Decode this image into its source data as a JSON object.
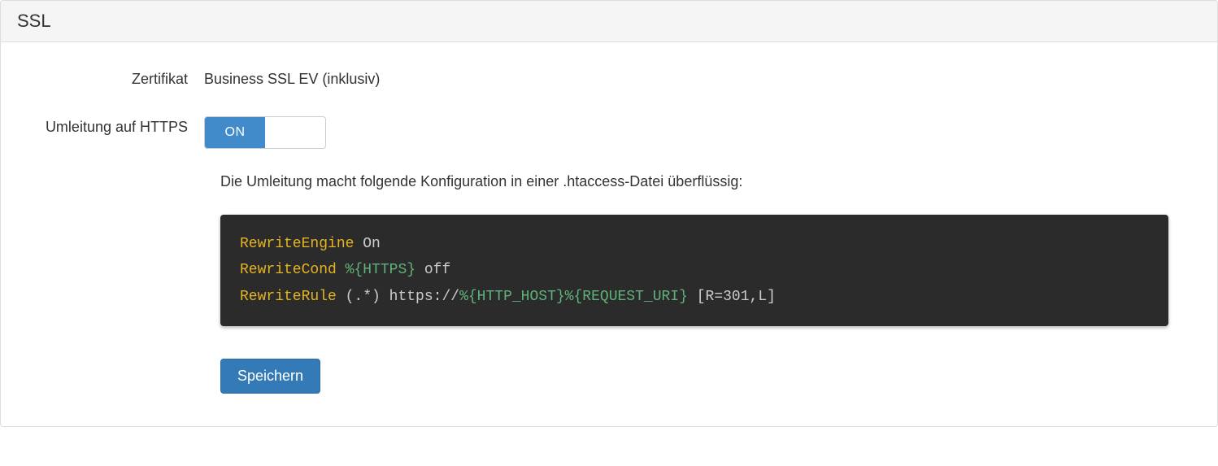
{
  "panel": {
    "title": "SSL"
  },
  "fields": {
    "certificate": {
      "label": "Zertifikat",
      "value": "Business SSL EV (inklusiv)"
    },
    "redirect": {
      "label": "Umleitung auf HTTPS",
      "toggle_state": "ON"
    }
  },
  "info_text": "Die Umleitung macht folgende Konfiguration in einer .htaccess-Datei überflüssig:",
  "code": {
    "line1_dir": "RewriteEngine",
    "line1_val": " On",
    "line2_dir": "RewriteCond",
    "line2_var": " %{HTTPS}",
    "line2_val": " off",
    "line3_dir": "RewriteRule",
    "line3_val1": " (.*) https://",
    "line3_var": "%{HTTP_HOST}%{REQUEST_URI}",
    "line3_val2": " [R=301,L]"
  },
  "actions": {
    "save_label": "Speichern"
  }
}
